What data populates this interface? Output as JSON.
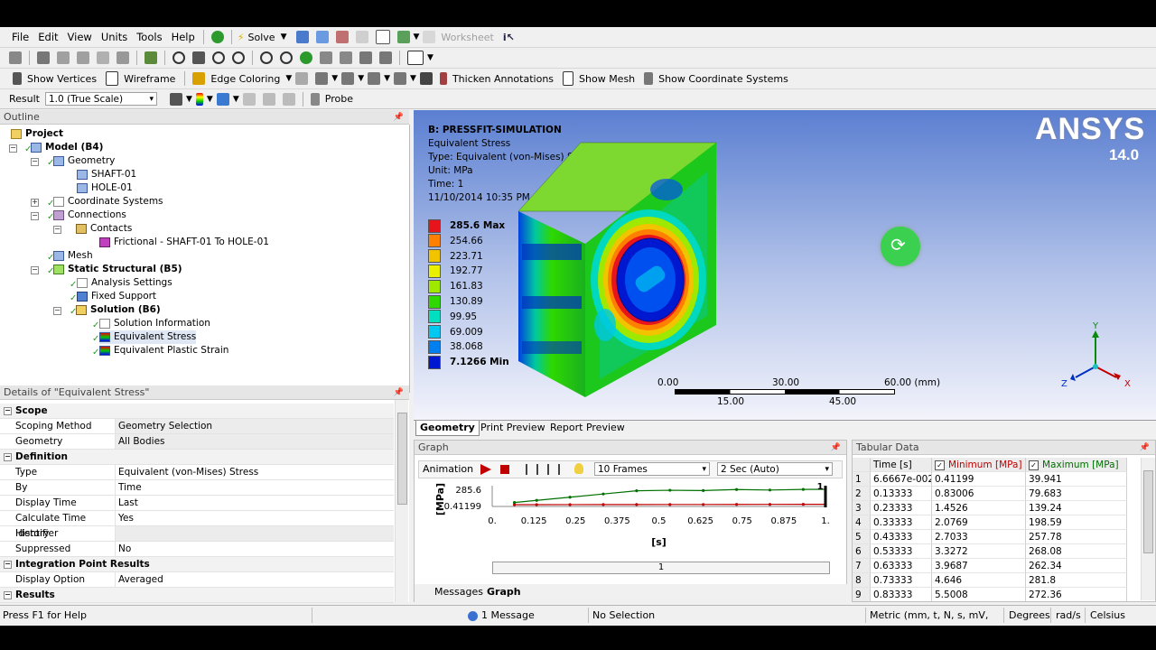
{
  "menu": [
    "File",
    "Edit",
    "View",
    "Units",
    "Tools",
    "Help"
  ],
  "toolbar1": {
    "solve": "Solve",
    "worksheet": "Worksheet"
  },
  "toolbar2": {
    "show_vertices": "Show Vertices",
    "wireframe": "Wireframe",
    "edge_coloring": "Edge Coloring",
    "thicken": "Thicken Annotations",
    "show_mesh": "Show Mesh",
    "show_coords": "Show Coordinate Systems"
  },
  "toolbar3": {
    "result_label": "Result",
    "scale_value": "1.0 (True Scale)",
    "probe": "Probe"
  },
  "outline": {
    "title": "Outline",
    "nodes": [
      "Project",
      "Model (B4)",
      "Geometry",
      "SHAFT-01",
      "HOLE-01",
      "Coordinate Systems",
      "Connections",
      "Contacts",
      "Frictional - SHAFT-01 To HOLE-01",
      "Mesh",
      "Static Structural (B5)",
      "Analysis Settings",
      "Fixed Support",
      "Solution (B6)",
      "Solution Information",
      "Equivalent Stress",
      "Equivalent Plastic Strain"
    ]
  },
  "details": {
    "title": "Details of \"Equivalent Stress\"",
    "rows": [
      {
        "k": "Scope",
        "v": ""
      },
      {
        "k": "Scoping Method",
        "v": "Geometry Selection"
      },
      {
        "k": "Geometry",
        "v": "All Bodies"
      },
      {
        "k": "Definition",
        "v": ""
      },
      {
        "k": "Type",
        "v": "Equivalent (von-Mises) Stress"
      },
      {
        "k": "By",
        "v": "Time"
      },
      {
        "k": "Display Time",
        "v": "Last"
      },
      {
        "k": "Calculate Time History",
        "v": "Yes"
      },
      {
        "k": "Identifier",
        "v": ""
      },
      {
        "k": "Suppressed",
        "v": "No"
      },
      {
        "k": "Integration Point Results",
        "v": ""
      },
      {
        "k": "Display Option",
        "v": "Averaged"
      },
      {
        "k": "Results",
        "v": ""
      }
    ]
  },
  "viewport": {
    "title": "B: PRESSFIT-SIMULATION",
    "line1": "Equivalent Stress",
    "line2": "Type: Equivalent (von-Mises) Stress",
    "line3": "Unit: MPa",
    "line4": "Time: 1",
    "line5": "11/10/2014 10:35 PM",
    "logo": "ANSYS",
    "version": "14.0",
    "legend": [
      {
        "label": "285.6 Max",
        "color": "#e8141b"
      },
      {
        "label": "254.66",
        "color": "#ff7f00"
      },
      {
        "label": "223.71",
        "color": "#f2c400"
      },
      {
        "label": "192.77",
        "color": "#e8f000"
      },
      {
        "label": "161.83",
        "color": "#9fe800"
      },
      {
        "label": "130.89",
        "color": "#2ed800"
      },
      {
        "label": "99.95",
        "color": "#00e0c0"
      },
      {
        "label": "69.009",
        "color": "#00c8f0"
      },
      {
        "label": "38.068",
        "color": "#0080f0"
      },
      {
        "label": "7.1266 Min",
        "color": "#0018d0"
      }
    ],
    "scale_top": [
      "0.00",
      "30.00",
      "60.00 (mm)"
    ],
    "scale_bottom": [
      "15.00",
      "45.00"
    ],
    "axes": {
      "y": "Y",
      "z": "Z",
      "x": "X"
    },
    "tabs": [
      "Geometry",
      "Print Preview",
      "Report Preview"
    ]
  },
  "graph": {
    "title": "Graph",
    "animation": "Animation",
    "frames": "10 Frames",
    "speed": "2 Sec (Auto)",
    "ylabel": "[MPa]",
    "y_top": "285.6",
    "y_bottom": "0.41199",
    "xlabel": "[s]",
    "end_label": "1.",
    "slider_value": "1",
    "tabs": [
      "Messages",
      "Graph"
    ]
  },
  "chart_data": {
    "type": "line",
    "x_ticks": [
      "0.",
      "0.125",
      "0.25",
      "0.375",
      "0.5",
      "0.625",
      "0.75",
      "0.875",
      "1."
    ],
    "ylim": [
      0.41199,
      285.6
    ],
    "xlim": [
      0,
      1
    ],
    "series": [
      {
        "name": "Minimum [MPa]",
        "color": "#c00000",
        "x": [
          0.066667,
          0.13333,
          0.23333,
          0.33333,
          0.43333,
          0.53333,
          0.63333,
          0.73333,
          0.83333,
          0.93333,
          1.0
        ],
        "values": [
          0.41199,
          0.83006,
          1.4526,
          2.0769,
          2.7033,
          3.3272,
          3.9687,
          4.646,
          5.5008,
          6.3,
          7.1266
        ]
      },
      {
        "name": "Maximum [MPa]",
        "color": "#007000",
        "x": [
          0.066667,
          0.13333,
          0.23333,
          0.33333,
          0.43333,
          0.53333,
          0.63333,
          0.73333,
          0.83333,
          0.93333,
          1.0
        ],
        "values": [
          39.941,
          79.683,
          139.24,
          198.59,
          257.78,
          268.08,
          262.34,
          281.8,
          272.36,
          283.0,
          285.6
        ]
      }
    ]
  },
  "tabular": {
    "title": "Tabular Data",
    "columns": [
      "",
      "Time [s]",
      "Minimum [MPa]",
      "Maximum [MPa]"
    ],
    "rows": [
      [
        "1",
        "6.6667e-002",
        "0.41199",
        "39.941"
      ],
      [
        "2",
        "0.13333",
        "0.83006",
        "79.683"
      ],
      [
        "3",
        "0.23333",
        "1.4526",
        "139.24"
      ],
      [
        "4",
        "0.33333",
        "2.0769",
        "198.59"
      ],
      [
        "5",
        "0.43333",
        "2.7033",
        "257.78"
      ],
      [
        "6",
        "0.53333",
        "3.3272",
        "268.08"
      ],
      [
        "7",
        "0.63333",
        "3.9687",
        "262.34"
      ],
      [
        "8",
        "0.73333",
        "4.646",
        "281.8"
      ],
      [
        "9",
        "0.83333",
        "5.5008",
        "272.36"
      ]
    ]
  },
  "status": {
    "help": "Press F1 for Help",
    "messages": "1 Message",
    "selection": "No Selection",
    "units": "Metric (mm, t, N, s, mV, mA)",
    "angle": "Degrees",
    "rate": "rad/s",
    "temp": "Celsius"
  }
}
